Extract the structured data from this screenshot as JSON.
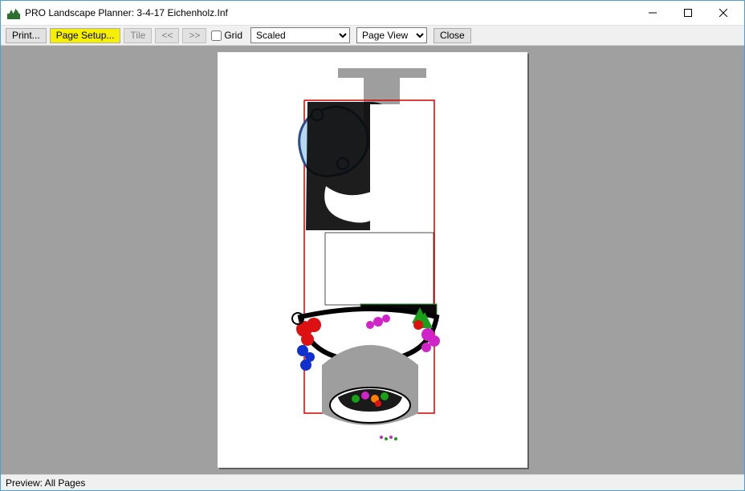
{
  "title": "PRO Landscape Planner: 3-4-17 Eichenholz.Inf",
  "toolbar": {
    "print": "Print...",
    "page_setup": "Page Setup...",
    "tile": "Tile",
    "prev": "<<",
    "next": ">>",
    "grid_label": "Grid",
    "grid_checked": false,
    "scale_select": "Scaled",
    "view_select": "Page View",
    "close": "Close"
  },
  "status": "Preview: All Pages"
}
